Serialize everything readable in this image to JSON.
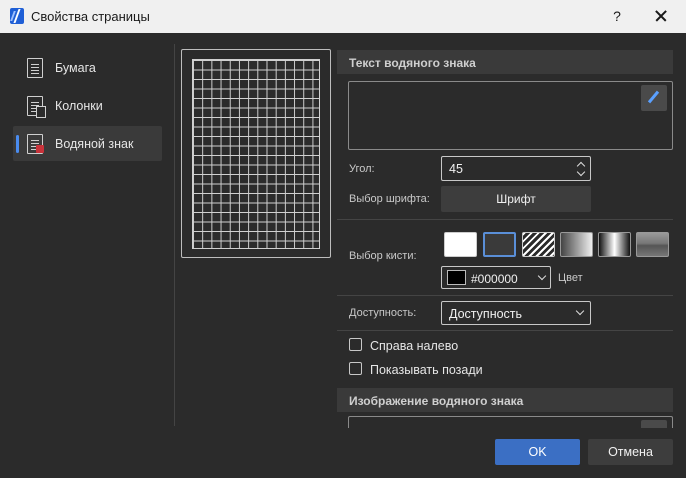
{
  "window": {
    "title": "Свойства страницы",
    "help_label": "?",
    "icon": "app-logo-icon"
  },
  "nav": {
    "items": [
      {
        "label": "Бумага",
        "icon": "page-icon"
      },
      {
        "label": "Колонки",
        "icon": "columns-page-icon"
      },
      {
        "label": "Водяной знак",
        "icon": "watermark-page-icon",
        "active": true
      }
    ]
  },
  "watermark_text": {
    "heading": "Текст водяного знака",
    "text_value": "",
    "angle_label": "Угол:",
    "angle_value": "45",
    "font_label": "Выбор шрифта:",
    "font_button": "Шрифт",
    "brush_label": "Выбор кисти:",
    "brushes": [
      "solid",
      "none",
      "hatch",
      "linear-gradient",
      "radial-gradient",
      "texture"
    ],
    "selected_brush": "none",
    "color_value": "#000000",
    "color_label": "Цвет",
    "accessibility_label": "Доступность:",
    "accessibility_value": "Доступность",
    "rtl_label": "Справа налево",
    "rtl_checked": false,
    "behind_label": "Показывать позади",
    "behind_checked": false
  },
  "watermark_image": {
    "heading": "Изображение водяного знака"
  },
  "footer": {
    "ok_label": "OK",
    "cancel_label": "Отмена"
  },
  "colors": {
    "accent": "#3b6fc4",
    "background": "#2b2b2b",
    "titlebar": "#f0f0f0"
  }
}
